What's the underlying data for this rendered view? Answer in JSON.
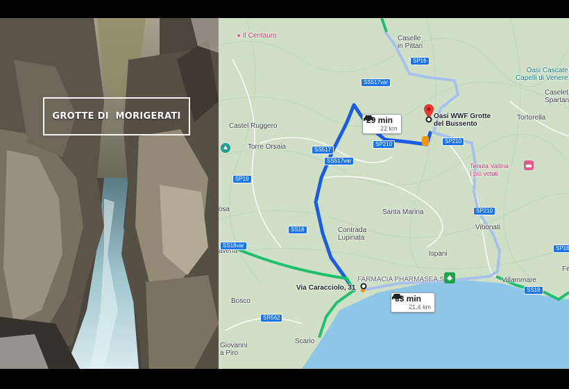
{
  "photo": {
    "title": "GROTTE DI  MORIGERATI"
  },
  "map": {
    "places": [
      {
        "id": "il-centauro",
        "text": "Il Centauro",
        "style": "pink"
      },
      {
        "id": "caselle",
        "text": "Caselle\nin Pittari",
        "style": ""
      },
      {
        "id": "oasi-cascate",
        "text": "Oasi Cascate\nCapelli di Venere",
        "style": "teal"
      },
      {
        "id": "caselet",
        "text": "Caselet\nSpartan",
        "style": ""
      },
      {
        "id": "tortorella",
        "text": "Tortorella",
        "style": ""
      },
      {
        "id": "castel-ruggero",
        "text": "Castel Ruggero",
        "style": ""
      },
      {
        "id": "torre-orsaia",
        "text": "Torre Orsaia",
        "style": ""
      },
      {
        "id": "oasi-wwf",
        "text": "Oasi WWF Grotte\ndel Bussento",
        "style": "dark"
      },
      {
        "id": "tenuta-vallina",
        "text": "Tenuta Vallina\nI più votati",
        "style": "pink"
      },
      {
        "id": "santa-marina",
        "text": "Santa Marina",
        "style": ""
      },
      {
        "id": "contrada",
        "text": "Contrada\nLupinata",
        "style": ""
      },
      {
        "id": "vibonati",
        "text": "Vibonati",
        "style": ""
      },
      {
        "id": "ispani",
        "text": "Ispani",
        "style": ""
      },
      {
        "id": "osa",
        "text": "osa",
        "style": ""
      },
      {
        "id": "avena",
        "text": "avena",
        "style": ""
      },
      {
        "id": "farmacia",
        "text": "FARMACIA PHARMASEA SRL",
        "style": ""
      },
      {
        "id": "via-caracciolo",
        "text": "Via Caracciolo, 31",
        "style": "dark"
      },
      {
        "id": "villammare",
        "text": "Villammare",
        "style": ""
      },
      {
        "id": "bosco",
        "text": "Bosco",
        "style": ""
      },
      {
        "id": "giovanni",
        "text": "Giovanni\na Piro",
        "style": ""
      },
      {
        "id": "scario",
        "text": "Scario",
        "style": ""
      },
      {
        "id": "fe",
        "text": "Fe",
        "style": ""
      }
    ],
    "road_shields": [
      {
        "id": "sp16",
        "text": "SP16",
        "color": "blue"
      },
      {
        "id": "ss517var-top",
        "text": "SS517var",
        "color": "blue"
      },
      {
        "id": "sp210-a",
        "text": "SP210",
        "color": "blue"
      },
      {
        "id": "sp210-b",
        "text": "SP210",
        "color": "blue"
      },
      {
        "id": "ss517",
        "text": "SS517",
        "color": "blue"
      },
      {
        "id": "ss517var-mid",
        "text": "SS517var",
        "color": "blue"
      },
      {
        "id": "sp19",
        "text": "SP19",
        "color": "blue"
      },
      {
        "id": "sp210-c",
        "text": "SP210",
        "color": "blue"
      },
      {
        "id": "ss18-a",
        "text": "SS18",
        "color": "blue"
      },
      {
        "id": "ss18var",
        "text": "SS18var",
        "color": "blue"
      },
      {
        "id": "sp16-b",
        "text": "SP16",
        "color": "blue"
      },
      {
        "id": "ss18-b",
        "text": "SS18",
        "color": "blue"
      },
      {
        "id": "sr562",
        "text": "SR562",
        "color": "blue"
      }
    ],
    "route_primary": {
      "time": "29 min",
      "distance": "22 km"
    },
    "route_alternate": {
      "time": "33 min",
      "distance": "21,4 km"
    },
    "colors": {
      "route_primary": "#1a5ce6",
      "route_alternate": "#a8c0ec",
      "highway": "#1fbf6e",
      "sea": "#8ec6e8",
      "land": "#cfe0c6",
      "destination_pin": "#e53935"
    }
  }
}
